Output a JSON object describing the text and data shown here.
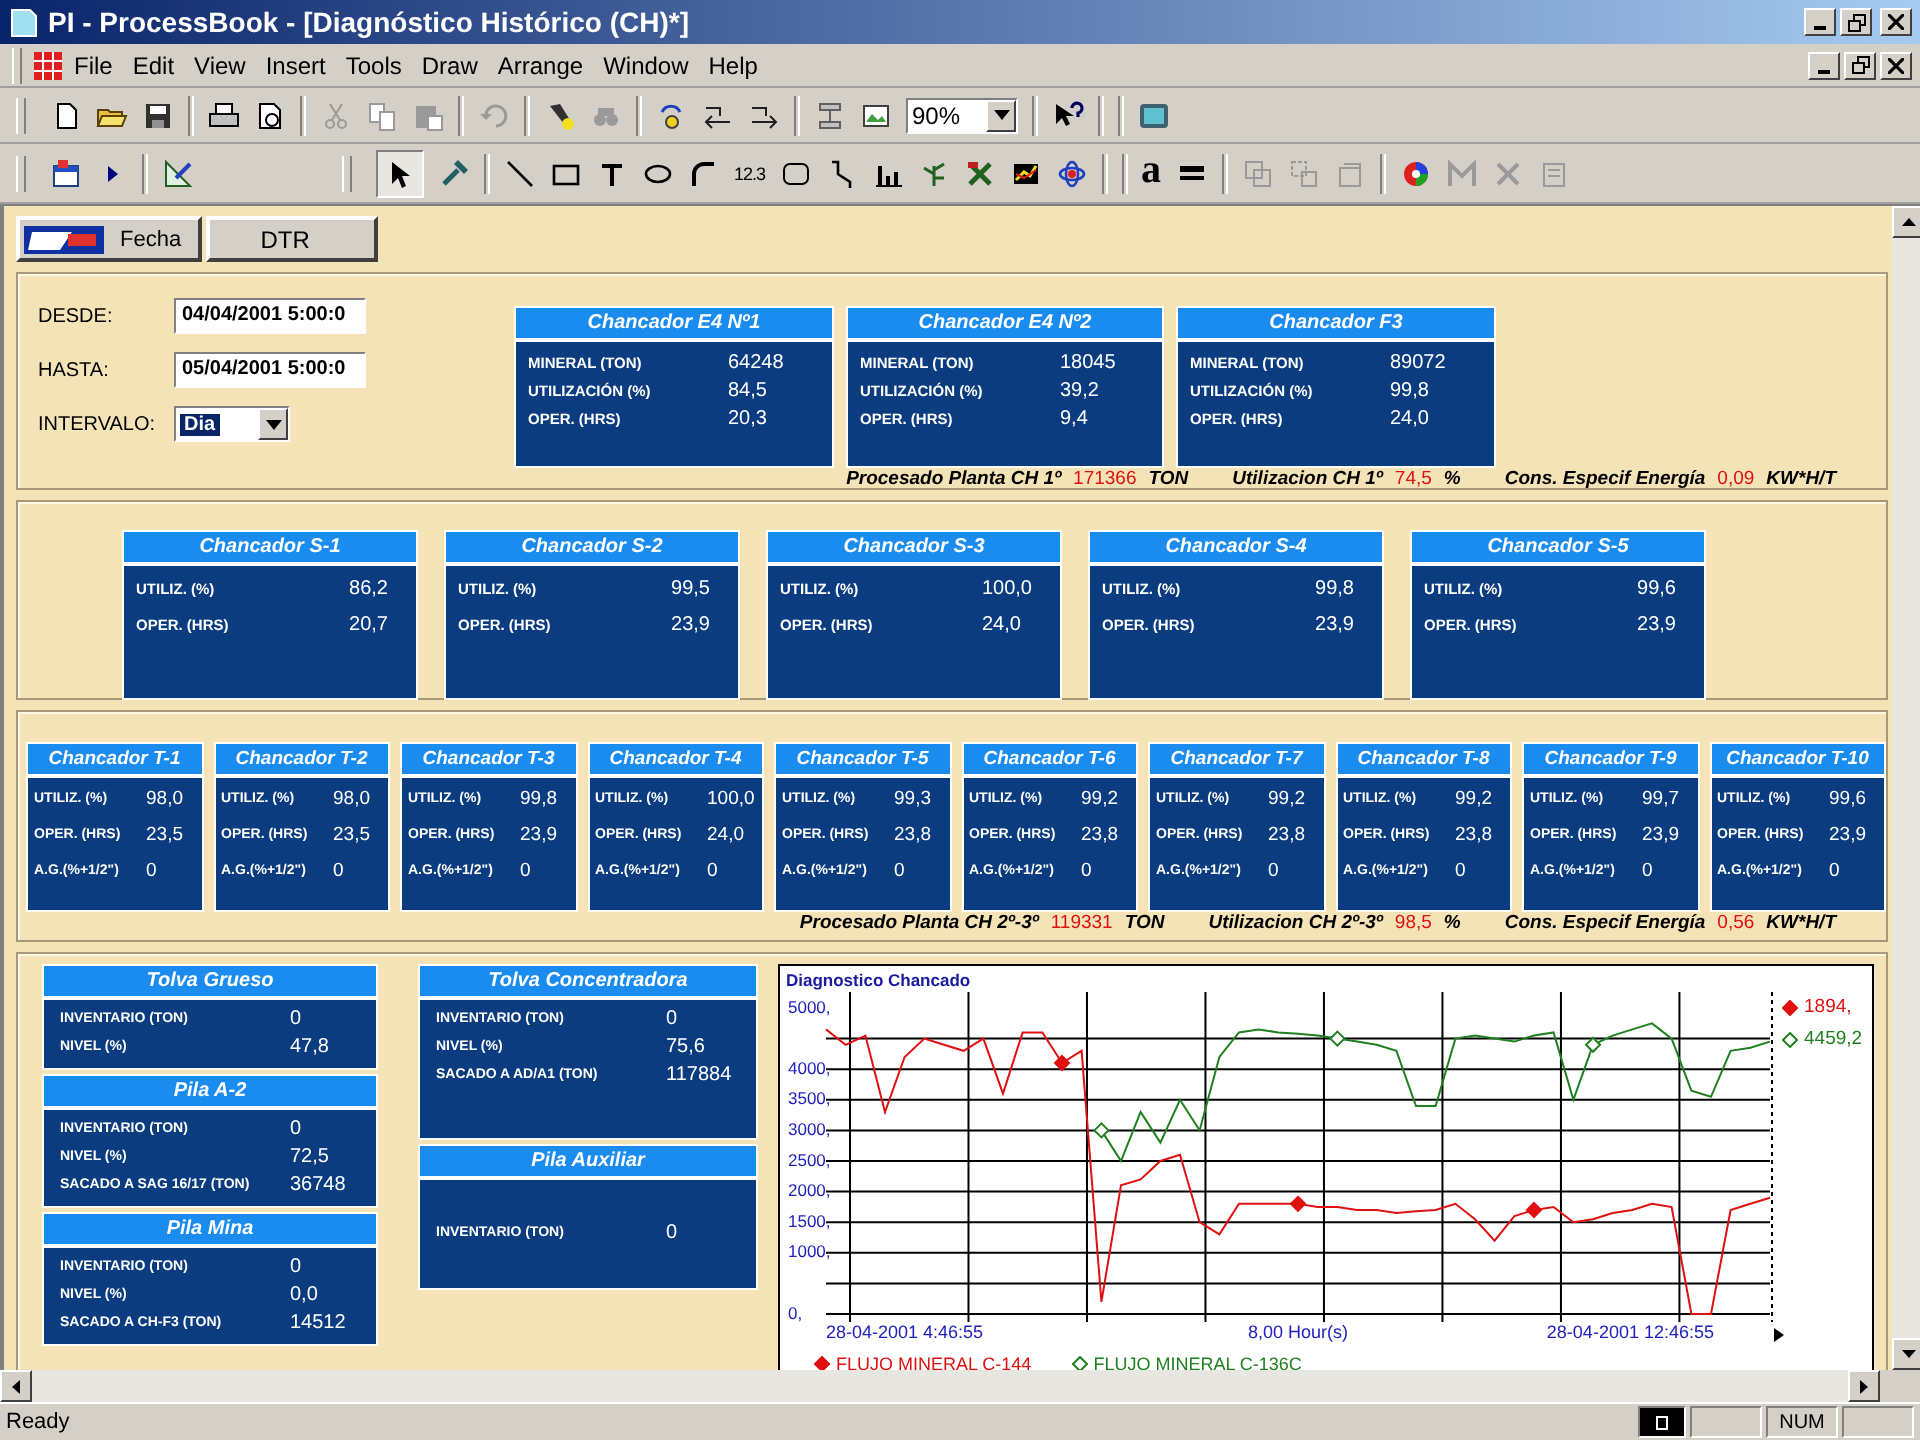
{
  "window": {
    "title": "PI - ProcessBook - [Diagnóstico Histórico (CH)*]"
  },
  "menu": [
    "File",
    "Edit",
    "View",
    "Insert",
    "Tools",
    "Draw",
    "Arrange",
    "Window",
    "Help"
  ],
  "toolbar": {
    "zoom": "90%",
    "value_tool": "12.3",
    "font_tool": "a"
  },
  "buttons": [
    {
      "label": "Fecha",
      "kind": "image"
    },
    {
      "label": "DTR",
      "kind": "plain"
    }
  ],
  "form": {
    "fields": [
      {
        "label": "DESDE:",
        "value": "04/04/2001 5:00:0"
      },
      {
        "label": "HASTA:",
        "value": "05/04/2001 5:00:0"
      }
    ],
    "interval": {
      "label": "INTERVALO:",
      "value": "Dia"
    }
  },
  "primary": [
    {
      "title": "Chancador E4 Nº1",
      "rows": [
        {
          "label": "MINERAL (TON)",
          "value": "64248"
        },
        {
          "label": "UTILIZACIÓN (%)",
          "value": "84,5"
        },
        {
          "label": "OPER. (HRS)",
          "value": "20,3"
        }
      ]
    },
    {
      "title": "Chancador E4 Nº2",
      "rows": [
        {
          "label": "MINERAL (TON)",
          "value": "18045"
        },
        {
          "label": "UTILIZACIÓN (%)",
          "value": "39,2"
        },
        {
          "label": "OPER. (HRS)",
          "value": "9,4"
        }
      ]
    },
    {
      "title": "Chancador F3",
      "rows": [
        {
          "label": "MINERAL (TON)",
          "value": "89072"
        },
        {
          "label": "UTILIZACIÓN (%)",
          "value": "99,8"
        },
        {
          "label": "OPER. (HRS)",
          "value": "24,0"
        }
      ]
    }
  ],
  "summary_1": [
    {
      "label": "Procesado Planta CH 1º",
      "value": "171366",
      "unit": "TON"
    },
    {
      "label": "Utilizacion CH 1º",
      "value": "74,5",
      "unit": "%"
    },
    {
      "label": "Cons. Especif Energía",
      "value": "0,09",
      "unit": "KW*H/T"
    }
  ],
  "secondary": [
    {
      "title": "Chancador S-1",
      "rows": [
        {
          "label": "UTILIZ. (%)",
          "value": "86,2"
        },
        {
          "label": "OPER. (HRS)",
          "value": "20,7"
        }
      ]
    },
    {
      "title": "Chancador S-2",
      "rows": [
        {
          "label": "UTILIZ. (%)",
          "value": "99,5"
        },
        {
          "label": "OPER. (HRS)",
          "value": "23,9"
        }
      ]
    },
    {
      "title": "Chancador S-3",
      "rows": [
        {
          "label": "UTILIZ. (%)",
          "value": "100,0"
        },
        {
          "label": "OPER. (HRS)",
          "value": "24,0"
        }
      ]
    },
    {
      "title": "Chancador S-4",
      "rows": [
        {
          "label": "UTILIZ. (%)",
          "value": "99,8"
        },
        {
          "label": "OPER. (HRS)",
          "value": "23,9"
        }
      ]
    },
    {
      "title": "Chancador S-5",
      "rows": [
        {
          "label": "UTILIZ. (%)",
          "value": "99,6"
        },
        {
          "label": "OPER. (HRS)",
          "value": "23,9"
        }
      ]
    }
  ],
  "tertiary": [
    {
      "title": "Chancador T-1",
      "rows": [
        {
          "label": "UTILIZ. (%)",
          "value": "98,0"
        },
        {
          "label": "OPER. (HRS)",
          "value": "23,5"
        },
        {
          "label": "A.G.(%+1/2\")",
          "value": "0"
        }
      ]
    },
    {
      "title": "Chancador T-2",
      "rows": [
        {
          "label": "UTILIZ. (%)",
          "value": "98,0"
        },
        {
          "label": "OPER. (HRS)",
          "value": "23,5"
        },
        {
          "label": "A.G.(%+1/2\")",
          "value": "0"
        }
      ]
    },
    {
      "title": "Chancador T-3",
      "rows": [
        {
          "label": "UTILIZ. (%)",
          "value": "99,8"
        },
        {
          "label": "OPER. (HRS)",
          "value": "23,9"
        },
        {
          "label": "A.G.(%+1/2\")",
          "value": "0"
        }
      ]
    },
    {
      "title": "Chancador T-4",
      "rows": [
        {
          "label": "UTILIZ. (%)",
          "value": "100,0"
        },
        {
          "label": "OPER. (HRS)",
          "value": "24,0"
        },
        {
          "label": "A.G.(%+1/2\")",
          "value": "0"
        }
      ]
    },
    {
      "title": "Chancador T-5",
      "rows": [
        {
          "label": "UTILIZ. (%)",
          "value": "99,3"
        },
        {
          "label": "OPER. (HRS)",
          "value": "23,8"
        },
        {
          "label": "A.G.(%+1/2\")",
          "value": "0"
        }
      ]
    },
    {
      "title": "Chancador T-6",
      "rows": [
        {
          "label": "UTILIZ. (%)",
          "value": "99,2"
        },
        {
          "label": "OPER. (HRS)",
          "value": "23,8"
        },
        {
          "label": "A.G.(%+1/2\")",
          "value": "0"
        }
      ]
    },
    {
      "title": "Chancador T-7",
      "rows": [
        {
          "label": "UTILIZ. (%)",
          "value": "99,2"
        },
        {
          "label": "OPER. (HRS)",
          "value": "23,8"
        },
        {
          "label": "A.G.(%+1/2\")",
          "value": "0"
        }
      ]
    },
    {
      "title": "Chancador T-8",
      "rows": [
        {
          "label": "UTILIZ. (%)",
          "value": "99,2"
        },
        {
          "label": "OPER. (HRS)",
          "value": "23,8"
        },
        {
          "label": "A.G.(%+1/2\")",
          "value": "0"
        }
      ]
    },
    {
      "title": "Chancador T-9",
      "rows": [
        {
          "label": "UTILIZ. (%)",
          "value": "99,7"
        },
        {
          "label": "OPER. (HRS)",
          "value": "23,9"
        },
        {
          "label": "A.G.(%+1/2\")",
          "value": "0"
        }
      ]
    },
    {
      "title": "Chancador T-10",
      "rows": [
        {
          "label": "UTILIZ. (%)",
          "value": "99,6"
        },
        {
          "label": "OPER. (HRS)",
          "value": "23,9"
        },
        {
          "label": "A.G.(%+1/2\")",
          "value": "0"
        }
      ]
    }
  ],
  "summary_2": [
    {
      "label": "Procesado Planta CH 2º-3º",
      "value": "119331",
      "unit": "TON"
    },
    {
      "label": "Utilizacion CH 2º-3º",
      "value": "98,5",
      "unit": "%"
    },
    {
      "label": "Cons. Especif Energía",
      "value": "0,56",
      "unit": "KW*H/T"
    }
  ],
  "storage": {
    "column_1": [
      {
        "title": "Tolva Grueso",
        "rows": [
          {
            "label": "INVENTARIO (TON)",
            "value": "0"
          },
          {
            "label": "NIVEL (%)",
            "value": "47,8"
          }
        ]
      },
      {
        "title": "Pila A-2",
        "rows": [
          {
            "label": "INVENTARIO (TON)",
            "value": "0"
          },
          {
            "label": "NIVEL (%)",
            "value": "72,5"
          },
          {
            "label": "SACADO A SAG 16/17 (TON)",
            "value": "36748"
          }
        ]
      },
      {
        "title": "Pila Mina",
        "rows": [
          {
            "label": "INVENTARIO (TON)",
            "value": "0"
          },
          {
            "label": "NIVEL (%)",
            "value": "0,0"
          },
          {
            "label": "SACADO A CH-F3 (TON)",
            "value": "14512"
          }
        ]
      }
    ],
    "column_2": [
      {
        "title": "Tolva Concentradora",
        "rows": [
          {
            "label": "INVENTARIO (TON)",
            "value": "0"
          },
          {
            "label": "NIVEL (%)",
            "value": "75,6"
          },
          {
            "label": "SACADO A AD/A1 (TON)",
            "value": "117884"
          }
        ]
      },
      {
        "title": "Pila Auxiliar",
        "rows": [
          {
            "label": "INVENTARIO (TON)",
            "value": "0"
          }
        ]
      }
    ]
  },
  "trend": {
    "x_labels": [
      "28-04-2001 4:46:55",
      "28-04-2001 12:46:55"
    ],
    "chart_data": {
      "type": "line",
      "grid": true,
      "legend": "bottom",
      "title": "Diagnostico Chancado",
      "xlabel": "8,00 Hour(s)",
      "categories": [
        null,
        null,
        null,
        null,
        null,
        null,
        null,
        null,
        null,
        null,
        null,
        null,
        null,
        null,
        null,
        null,
        null,
        null,
        null,
        null,
        null,
        null,
        null,
        null,
        null,
        null,
        null,
        null,
        null,
        null,
        null,
        null,
        null,
        null,
        null,
        null,
        null,
        null,
        null,
        null,
        null,
        null,
        null,
        null,
        null,
        null,
        null,
        null,
        null
      ],
      "ylim": [
        0,
        5000
      ],
      "yticks": [
        {
          "value": 5000,
          "label": "5000,"
        },
        {
          "value": 4000,
          "label": "4000,"
        },
        {
          "value": 3500,
          "label": "3500,"
        },
        {
          "value": 3000,
          "label": "3000,"
        },
        {
          "value": 2500,
          "label": "2500,"
        },
        {
          "value": 2000,
          "label": "2000,"
        },
        {
          "value": 1500,
          "label": "1500,"
        },
        {
          "value": 1000,
          "label": "1000,"
        },
        {
          "value": 0,
          "label": "0,"
        }
      ],
      "series": [
        {
          "name": "FLUJO MINERAL C-144",
          "color": "#e01010",
          "values": [
            4650,
            4400,
            4550,
            3300,
            4200,
            4500,
            4400,
            4300,
            4500,
            3600,
            4600,
            4600,
            4100,
            4300,
            200,
            2100,
            2200,
            2500,
            2600,
            1500,
            1300,
            1800,
            1800,
            1800,
            1800,
            1750,
            1750,
            1700,
            1700,
            1650,
            1680,
            1700,
            1800,
            1550,
            1200,
            1600,
            1700,
            1750,
            1500,
            1550,
            1650,
            1700,
            1800,
            1750,
            0,
            0,
            1700,
            1800,
            1900
          ]
        },
        {
          "name": "FLUJO MINERAL C-136C",
          "color": "#208020",
          "values": [
            null,
            null,
            null,
            null,
            null,
            null,
            null,
            null,
            null,
            null,
            null,
            null,
            null,
            null,
            3000,
            2500,
            3300,
            2800,
            3500,
            3000,
            4200,
            4600,
            4650,
            4600,
            4580,
            4550,
            4500,
            4450,
            4400,
            4300,
            3400,
            3400,
            4500,
            4550,
            4500,
            4450,
            4550,
            4600,
            3500,
            4400,
            4550,
            4650,
            4750,
            4500,
            3650,
            3550,
            4300,
            4350,
            4450
          ]
        }
      ]
    },
    "series_info": [
      {
        "current": "1894,",
        "filled_marker": true
      },
      {
        "current": "4459,2",
        "filled_marker": false
      }
    ]
  },
  "status_bar": {
    "text": "Ready",
    "indicators": [
      "NUM"
    ]
  }
}
